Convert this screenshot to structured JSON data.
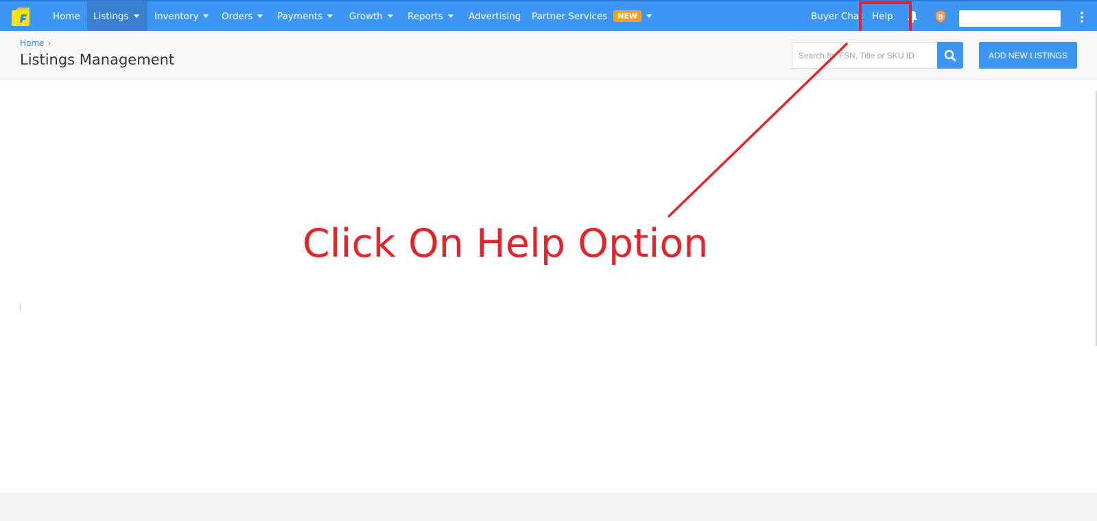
{
  "nav": {
    "items": [
      {
        "label": "Home",
        "has_caret": false
      },
      {
        "label": "Listings",
        "has_caret": true
      },
      {
        "label": "Inventory",
        "has_caret": true
      },
      {
        "label": "Orders",
        "has_caret": true
      },
      {
        "label": "Payments",
        "has_caret": true
      },
      {
        "label": "Growth",
        "has_caret": true
      },
      {
        "label": "Reports",
        "has_caret": true
      },
      {
        "label": "Advertising",
        "has_caret": false
      },
      {
        "label": "Partner Services",
        "has_caret": true
      }
    ],
    "new_badge": "NEW",
    "buyer_chat": "Buyer Chat",
    "help": "Help",
    "badge_letter": "B"
  },
  "breadcrumb": {
    "home": "Home"
  },
  "page_title": "Listings Management",
  "search": {
    "placeholder": "Search for FSN, Title or SKU ID"
  },
  "add_button": "ADD NEW LISTINGS",
  "annotation": "Click On Help Option",
  "colors": {
    "nav_bg": "#3d96f3",
    "nav_active": "#3a7fd0",
    "badge": "#f7a21b",
    "annotation": "#e3242b"
  }
}
